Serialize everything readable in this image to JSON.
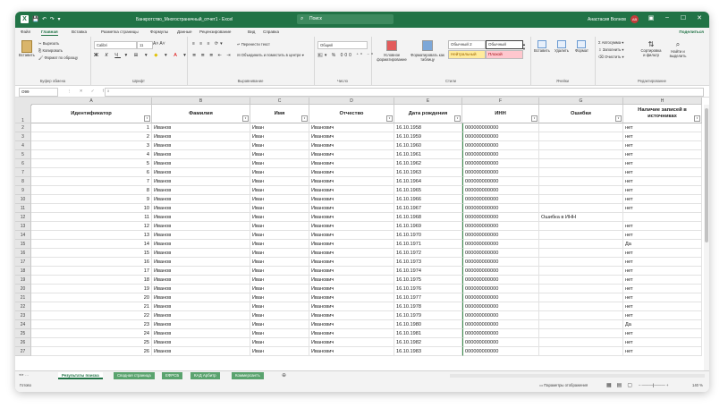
{
  "window": {
    "doc_title": "Банкротство_Многостраничный_отчет1 - Excel",
    "search_placeholder": "Поиск",
    "user_name": "Анастасия Волнов",
    "user_initials": "АВ"
  },
  "menu": {
    "tabs": [
      "Файл",
      "Главная",
      "Вставка",
      "Разметка страницы",
      "Формулы",
      "Данные",
      "Рецензирование",
      "Вид",
      "Справка"
    ],
    "active": "Главная",
    "share": "Поделиться"
  },
  "ribbon": {
    "clipboard": {
      "paste": "Вставить",
      "cut": "Вырезать",
      "copy": "Копировать",
      "format_painter": "Формат по образцу",
      "group": "Буфер обмена"
    },
    "font": {
      "name": "Calibri",
      "size": "11",
      "group": "Шрифт"
    },
    "alignment": {
      "wrap": "Перенести текст",
      "merge": "Объединить и поместить в центре",
      "group": "Выравнивание"
    },
    "number": {
      "format": "Общий",
      "group": "Число"
    },
    "styles": {
      "conditional": "Условное форматирование",
      "as_table": "Форматировать как таблицу",
      "normal2": "Обычный 2",
      "normal": "Обычный",
      "neutral": "Нейтральный",
      "bad": "Плохой",
      "group": "Стили"
    },
    "cells": {
      "insert": "Вставить",
      "delete": "Удалить",
      "format": "Формат",
      "group": "Ячейки"
    },
    "editing": {
      "autosum": "Автосумма",
      "fill": "Заполнить",
      "clear": "Очистить",
      "sort": "Сортировка и фильтр",
      "find": "Найти и выделить",
      "group": "Редактирование"
    }
  },
  "formula_bar": {
    "name_box": "O99",
    "value": ""
  },
  "columns": [
    "A",
    "B",
    "C",
    "D",
    "E",
    "F",
    "G",
    "H"
  ],
  "headers": [
    "Идентификатор",
    "Фамилия",
    "Имя",
    "Отчество",
    "Дата рождения",
    "ИНН",
    "Ошибки",
    "Наличие записей в источниках"
  ],
  "rows": [
    {
      "n": "2",
      "id": "1",
      "last": "Иванов",
      "first": "Иван",
      "middle": "Иванович",
      "dob": "16.10.1958",
      "inn": "000000000000",
      "err": "",
      "src": "нет"
    },
    {
      "n": "3",
      "id": "2",
      "last": "Иванов",
      "first": "Иван",
      "middle": "Иванович",
      "dob": "16.10.1959",
      "inn": "000000000000",
      "err": "",
      "src": "нет"
    },
    {
      "n": "4",
      "id": "3",
      "last": "Иванов",
      "first": "Иван",
      "middle": "Иванович",
      "dob": "16.10.1960",
      "inn": "000000000000",
      "err": "",
      "src": "нет"
    },
    {
      "n": "5",
      "id": "4",
      "last": "Иванов",
      "first": "Иван",
      "middle": "Иванович",
      "dob": "16.10.1961",
      "inn": "000000000000",
      "err": "",
      "src": "нет"
    },
    {
      "n": "6",
      "id": "5",
      "last": "Иванов",
      "first": "Иван",
      "middle": "Иванович",
      "dob": "16.10.1962",
      "inn": "000000000000",
      "err": "",
      "src": "нет"
    },
    {
      "n": "7",
      "id": "6",
      "last": "Иванов",
      "first": "Иван",
      "middle": "Иванович",
      "dob": "16.10.1963",
      "inn": "000000000000",
      "err": "",
      "src": "нет"
    },
    {
      "n": "8",
      "id": "7",
      "last": "Иванов",
      "first": "Иван",
      "middle": "Иванович",
      "dob": "16.10.1964",
      "inn": "000000000000",
      "err": "",
      "src": "нет"
    },
    {
      "n": "9",
      "id": "8",
      "last": "Иванов",
      "first": "Иван",
      "middle": "Иванович",
      "dob": "16.10.1965",
      "inn": "000000000000",
      "err": "",
      "src": "нет"
    },
    {
      "n": "10",
      "id": "9",
      "last": "Иванов",
      "first": "Иван",
      "middle": "Иванович",
      "dob": "16.10.1966",
      "inn": "000000000000",
      "err": "",
      "src": "нет"
    },
    {
      "n": "11",
      "id": "10",
      "last": "Иванов",
      "first": "Иван",
      "middle": "Иванович",
      "dob": "16.10.1967",
      "inn": "000000000000",
      "err": "",
      "src": "нет"
    },
    {
      "n": "12",
      "id": "11",
      "last": "Иванов",
      "first": "Иван",
      "middle": "Иванович",
      "dob": "16.10.1968",
      "inn": "000000000000",
      "err": "Ошибка в ИНН",
      "src": ""
    },
    {
      "n": "13",
      "id": "12",
      "last": "Иванов",
      "first": "Иван",
      "middle": "Иванович",
      "dob": "16.10.1969",
      "inn": "000000000000",
      "err": "",
      "src": "нет"
    },
    {
      "n": "14",
      "id": "13",
      "last": "Иванов",
      "first": "Иван",
      "middle": "Иванович",
      "dob": "16.10.1970",
      "inn": "000000000000",
      "err": "",
      "src": "нет"
    },
    {
      "n": "15",
      "id": "14",
      "last": "Иванов",
      "first": "Иван",
      "middle": "Иванович",
      "dob": "16.10.1971",
      "inn": "000000000000",
      "err": "",
      "src": "Да"
    },
    {
      "n": "16",
      "id": "15",
      "last": "Иванов",
      "first": "Иван",
      "middle": "Иванович",
      "dob": "16.10.1972",
      "inn": "000000000000",
      "err": "",
      "src": "нет"
    },
    {
      "n": "17",
      "id": "16",
      "last": "Иванов",
      "first": "Иван",
      "middle": "Иванович",
      "dob": "16.10.1973",
      "inn": "000000000000",
      "err": "",
      "src": "нет"
    },
    {
      "n": "18",
      "id": "17",
      "last": "Иванов",
      "first": "Иван",
      "middle": "Иванович",
      "dob": "16.10.1974",
      "inn": "000000000000",
      "err": "",
      "src": "нет"
    },
    {
      "n": "19",
      "id": "18",
      "last": "Иванов",
      "first": "Иван",
      "middle": "Иванович",
      "dob": "16.10.1975",
      "inn": "000000000000",
      "err": "",
      "src": "нет"
    },
    {
      "n": "20",
      "id": "19",
      "last": "Иванов",
      "first": "Иван",
      "middle": "Иванович",
      "dob": "16.10.1976",
      "inn": "000000000000",
      "err": "",
      "src": "нет"
    },
    {
      "n": "21",
      "id": "20",
      "last": "Иванов",
      "first": "Иван",
      "middle": "Иванович",
      "dob": "16.10.1977",
      "inn": "000000000000",
      "err": "",
      "src": "нет"
    },
    {
      "n": "22",
      "id": "21",
      "last": "Иванов",
      "first": "Иван",
      "middle": "Иванович",
      "dob": "16.10.1978",
      "inn": "000000000000",
      "err": "",
      "src": "нет"
    },
    {
      "n": "23",
      "id": "22",
      "last": "Иванов",
      "first": "Иван",
      "middle": "Иванович",
      "dob": "16.10.1979",
      "inn": "000000000000",
      "err": "",
      "src": "нет"
    },
    {
      "n": "24",
      "id": "23",
      "last": "Иванов",
      "first": "Иван",
      "middle": "Иванович",
      "dob": "16.10.1980",
      "inn": "000000000000",
      "err": "",
      "src": "Да"
    },
    {
      "n": "25",
      "id": "24",
      "last": "Иванов",
      "first": "Иван",
      "middle": "Иванович",
      "dob": "16.10.1981",
      "inn": "000000000000",
      "err": "",
      "src": "нет"
    },
    {
      "n": "26",
      "id": "25",
      "last": "Иванов",
      "first": "Иван",
      "middle": "Иванович",
      "dob": "16.10.1982",
      "inn": "000000000000",
      "err": "",
      "src": "нет"
    },
    {
      "n": "27",
      "id": "26",
      "last": "Иванов",
      "first": "Иван",
      "middle": "Иванович",
      "dob": "16.10.1983",
      "inn": "000000000000",
      "err": "",
      "src": "нет"
    }
  ],
  "sheets": [
    "Результаты поиска",
    "Сводная страница",
    "ЕФРСБ",
    "КАД Арбитр",
    "Коммерсантъ"
  ],
  "active_sheet": "Результаты поиска",
  "status": {
    "ready": "Готово",
    "display_settings": "Параметры отображения",
    "zoom": "140 %"
  },
  "colors": {
    "accent": "#217346",
    "tab_green": "#5aa36e"
  }
}
